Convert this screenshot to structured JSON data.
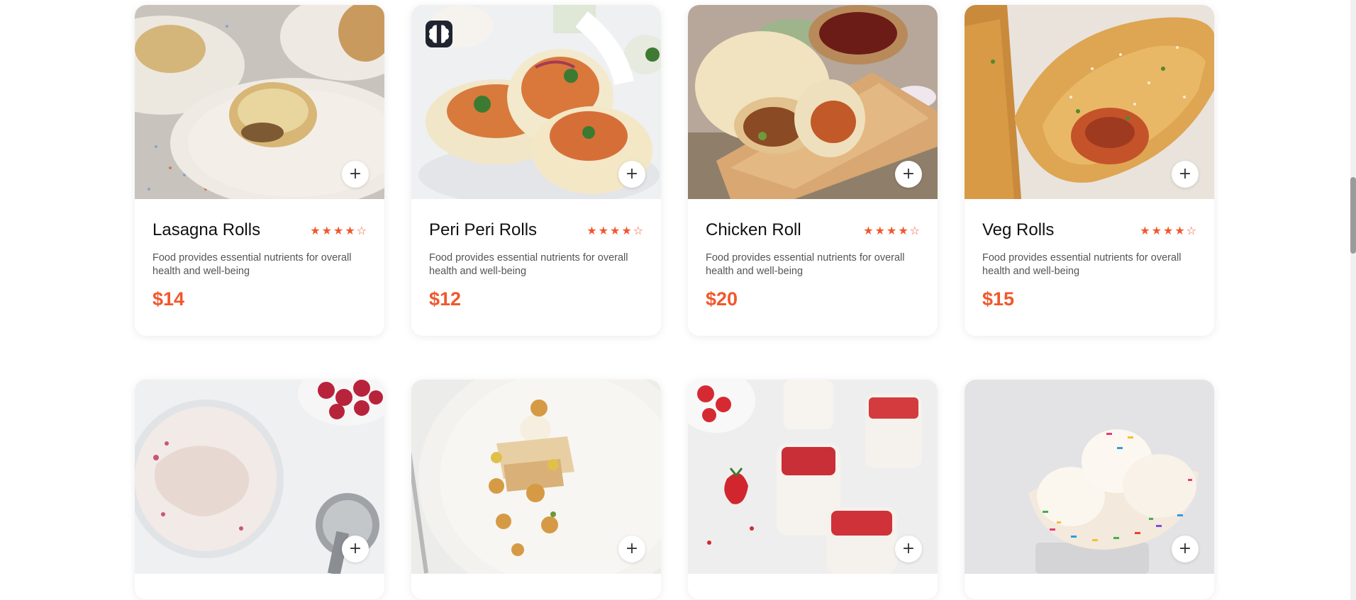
{
  "colors": {
    "accent": "#f0582d",
    "title": "#111111",
    "text": "#555555",
    "badge_bg": "#1f2430"
  },
  "products_row1": [
    {
      "title": "Lasagna Rolls",
      "rating": 4,
      "rating_max": 5,
      "description": "Food provides essential nutrients for overall health and well-being",
      "price": "$14",
      "add_label": "+",
      "image_icon": "lasagna-rolls-photo"
    },
    {
      "title": "Peri Peri Rolls",
      "rating": 4,
      "rating_max": 5,
      "description": "Food provides essential nutrients for overall health and well-being",
      "price": "$12",
      "add_label": "+",
      "image_icon": "peri-peri-rolls-photo",
      "badge_icon": "brain-icon"
    },
    {
      "title": "Chicken Roll",
      "rating": 4,
      "rating_max": 5,
      "description": "Food provides essential nutrients for overall health and well-being",
      "price": "$20",
      "add_label": "+",
      "image_icon": "chicken-roll-photo"
    },
    {
      "title": "Veg Rolls",
      "rating": 4,
      "rating_max": 5,
      "description": "Food provides essential nutrients for overall health and well-being",
      "price": "$15",
      "add_label": "+",
      "image_icon": "veg-rolls-photo"
    }
  ],
  "products_row2": [
    {
      "add_label": "+",
      "image_icon": "raspberry-ice-cream-photo"
    },
    {
      "add_label": "+",
      "image_icon": "plated-dessert-photo"
    },
    {
      "add_label": "+",
      "image_icon": "strawberry-panna-cotta-photo"
    },
    {
      "add_label": "+",
      "image_icon": "sprinkle-ice-cream-bowl-photo"
    }
  ]
}
